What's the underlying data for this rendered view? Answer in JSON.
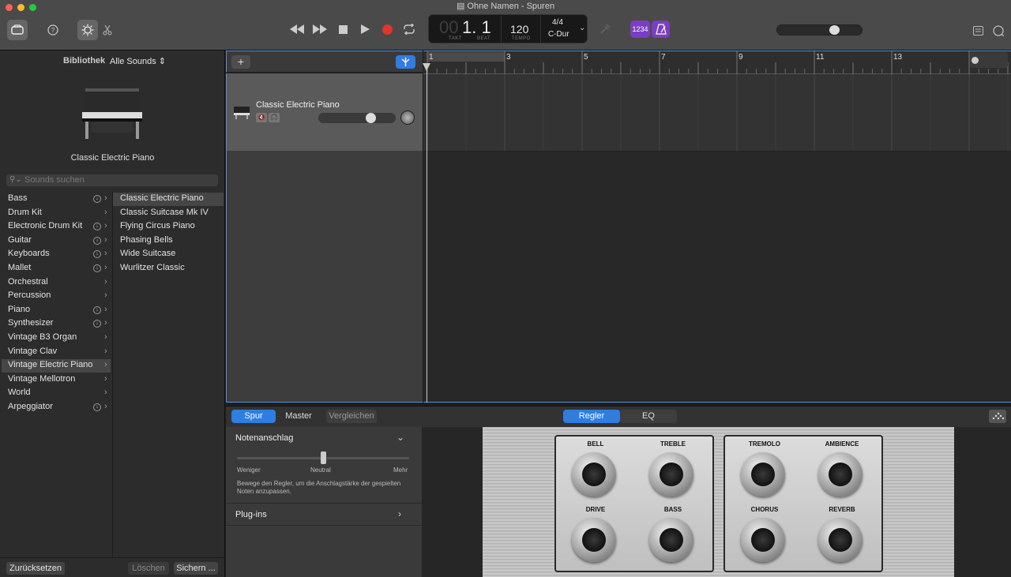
{
  "window": {
    "title": "Ohne Namen - Spuren"
  },
  "transport": {
    "bar_dim": "00",
    "position": "1. 1",
    "label_bar": "TAKT",
    "label_beat": "BEAT",
    "tempo": "120",
    "label_tempo": "TEMPO",
    "signature": "4/4",
    "key": "C-Dur",
    "count_in": "1234"
  },
  "library": {
    "title": "Bibliothek",
    "filter": "Alle Sounds",
    "preview_name": "Classic Electric Piano",
    "search_placeholder": "Sounds suchen",
    "categories": [
      {
        "label": "Bass",
        "download": true
      },
      {
        "label": "Drum Kit",
        "download": false
      },
      {
        "label": "Electronic Drum Kit",
        "download": true
      },
      {
        "label": "Guitar",
        "download": true
      },
      {
        "label": "Keyboards",
        "download": true
      },
      {
        "label": "Mallet",
        "download": true
      },
      {
        "label": "Orchestral",
        "download": false
      },
      {
        "label": "Percussion",
        "download": false
      },
      {
        "label": "Piano",
        "download": true
      },
      {
        "label": "Synthesizer",
        "download": true
      },
      {
        "label": "Vintage B3 Organ",
        "download": false
      },
      {
        "label": "Vintage Clav",
        "download": false
      },
      {
        "label": "Vintage Electric Piano",
        "download": false,
        "selected": true
      },
      {
        "label": "Vintage Mellotron",
        "download": false
      },
      {
        "label": "World",
        "download": false
      },
      {
        "label": "Arpeggiator",
        "download": true
      }
    ],
    "patches": [
      "Classic Electric Piano",
      "Classic Suitcase Mk IV",
      "Flying Circus Piano",
      "Phasing Bells",
      "Wide Suitcase",
      "Wurlitzer Classic"
    ],
    "reset_label": "Zurücksetzen",
    "delete_label": "Löschen",
    "save_label": "Sichern ..."
  },
  "tracks": [
    {
      "name": "Classic Electric Piano",
      "volume": 0.7
    }
  ],
  "ruler": {
    "bars": [
      "1",
      "3",
      "5",
      "7",
      "9",
      "11",
      "13"
    ]
  },
  "editor": {
    "tabs_left": [
      "Spur",
      "Master",
      "Vergleichen"
    ],
    "tabs_center": [
      "Regler",
      "EQ"
    ],
    "velocity_section": "Notenanschlag",
    "slider_min": "Weniger",
    "slider_mid": "Neutral",
    "slider_max": "Mehr",
    "velocity_value": 0.5,
    "description": "Bewege den Regler, um die Anschlagstärke der gespielten Noten anzupassen.",
    "plugins_label": "Plug-ins",
    "knobs": [
      "BELL",
      "TREBLE",
      "BASS",
      "DRIVE",
      "TREMOLO",
      "AMBIENCE",
      "CHORUS",
      "REVERB"
    ]
  },
  "colors": {
    "accent": "#2f7de1",
    "record": "#e0342c",
    "purple": "#7a3fc0"
  }
}
